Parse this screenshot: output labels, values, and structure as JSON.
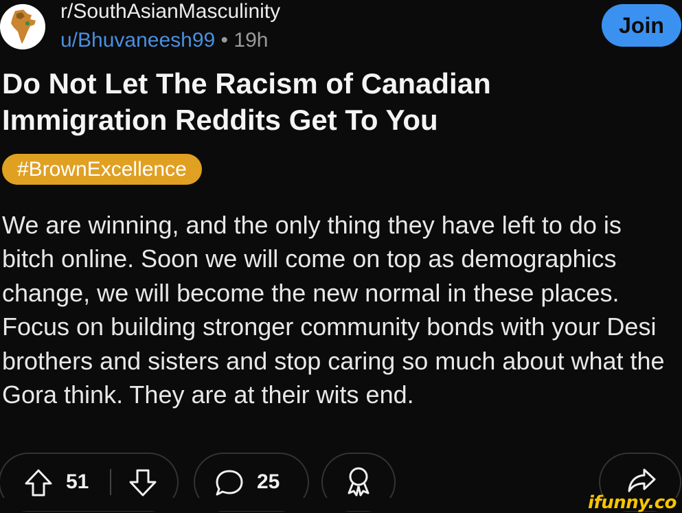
{
  "header": {
    "subreddit": "r/SouthAsianMasculinity",
    "username": "u/Bhuvaneesh99",
    "separator": "•",
    "time_ago": "19h",
    "join_label": "Join"
  },
  "post": {
    "title": "Do Not Let The Racism of Canadian Immigration Reddits Get To You",
    "flair": "#BrownExcellence",
    "body": "We are winning, and the only thing they have left to do is bitch online. Soon we will come on top as demographics change, we will become the new normal in these places. Focus on building stronger community bonds with your Desi brothers and sisters and stop caring so much about what the Gora think. They are at their wits end."
  },
  "actions": {
    "upvotes": "51",
    "comments": "25"
  },
  "watermark": "ifunny.co",
  "colors": {
    "background": "#0b0b0b",
    "join_button": "#3b91f0",
    "username": "#4a8fe0",
    "flair": "#e0a022",
    "watermark": "#f7c400"
  },
  "icons": {
    "avatar": "india-map-avatar-icon",
    "upvote": "arrow-up-icon",
    "downvote": "arrow-down-icon",
    "comment": "speech-bubble-icon",
    "award": "award-ribbon-icon",
    "share": "share-arrow-icon"
  }
}
